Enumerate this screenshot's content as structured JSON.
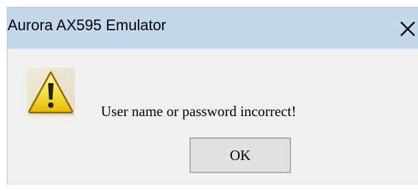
{
  "dialog": {
    "title": "Aurora AX595 Emulator",
    "close_glyph": "✕",
    "icon": "warning-icon",
    "message": "User name or password incorrect!",
    "ok_label": "OK"
  },
  "colors": {
    "titlebar": "#c4d7eb",
    "body": "#f0f0f0",
    "button": "#e1e1e1",
    "icon_fill": "#f7e04b",
    "icon_outline": "#8c6a00"
  }
}
